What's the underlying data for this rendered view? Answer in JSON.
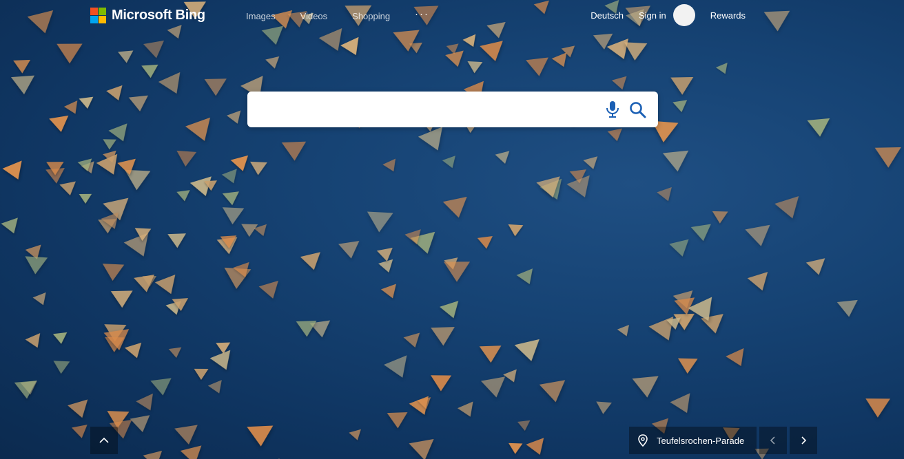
{
  "brand": {
    "name": "Microsoft Bing",
    "logo_colors": [
      "#f25022",
      "#7fba00",
      "#00a4ef",
      "#ffb900"
    ]
  },
  "nav": {
    "items": [
      {
        "label": "Images"
      },
      {
        "label": "Videos"
      },
      {
        "label": "Shopping"
      }
    ],
    "more_label": "···"
  },
  "header_right": {
    "language": "Deutsch",
    "sign_in": "Sign in",
    "rewards": "Rewards"
  },
  "search": {
    "value": "",
    "placeholder": ""
  },
  "background": {
    "caption": "Teufelsrochen-Parade"
  },
  "icons": {
    "mic": "microphone-icon",
    "search": "search-icon",
    "chevron_up": "chevron-up-icon",
    "location": "location-pin-icon",
    "prev": "chevron-left-icon",
    "next": "chevron-right-icon"
  }
}
